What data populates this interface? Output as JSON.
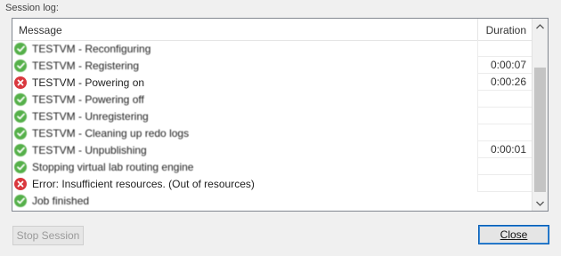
{
  "section_label": "Session log:",
  "table": {
    "columns": {
      "message": "Message",
      "duration": "Duration"
    },
    "rows": [
      {
        "status": "success",
        "icon": "check-circle-icon",
        "message": "TESTVM - Reconfiguring",
        "duration": ""
      },
      {
        "status": "success",
        "icon": "check-circle-icon",
        "message": "TESTVM - Registering",
        "duration": "0:00:07"
      },
      {
        "status": "error",
        "icon": "error-circle-icon",
        "message": "TESTVM - Powering on",
        "duration": "0:00:26"
      },
      {
        "status": "success",
        "icon": "check-circle-icon",
        "message": "TESTVM - Powering off",
        "duration": ""
      },
      {
        "status": "success",
        "icon": "check-circle-icon",
        "message": "TESTVM - Unregistering",
        "duration": ""
      },
      {
        "status": "success",
        "icon": "check-circle-icon",
        "message": "TESTVM - Cleaning up redo logs",
        "duration": ""
      },
      {
        "status": "success",
        "icon": "check-circle-icon",
        "message": "TESTVM - Unpublishing",
        "duration": "0:00:01"
      },
      {
        "status": "success",
        "icon": "check-circle-icon",
        "message": "Stopping virtual lab routing engine",
        "duration": ""
      },
      {
        "status": "error",
        "icon": "error-circle-icon",
        "message": "Error: Insufficient resources. (Out of resources)",
        "duration": ""
      },
      {
        "status": "success",
        "icon": "check-circle-icon",
        "message": "Job finished",
        "duration": ""
      }
    ]
  },
  "buttons": {
    "stop_session": "Stop Session",
    "close": "Close"
  },
  "colors": {
    "success": "#55b04a",
    "error": "#d9383e",
    "close_border": "#0a5fb4"
  },
  "scrollbar": {
    "up_icon": "chevron-up-icon",
    "down_icon": "chevron-down-icon"
  }
}
